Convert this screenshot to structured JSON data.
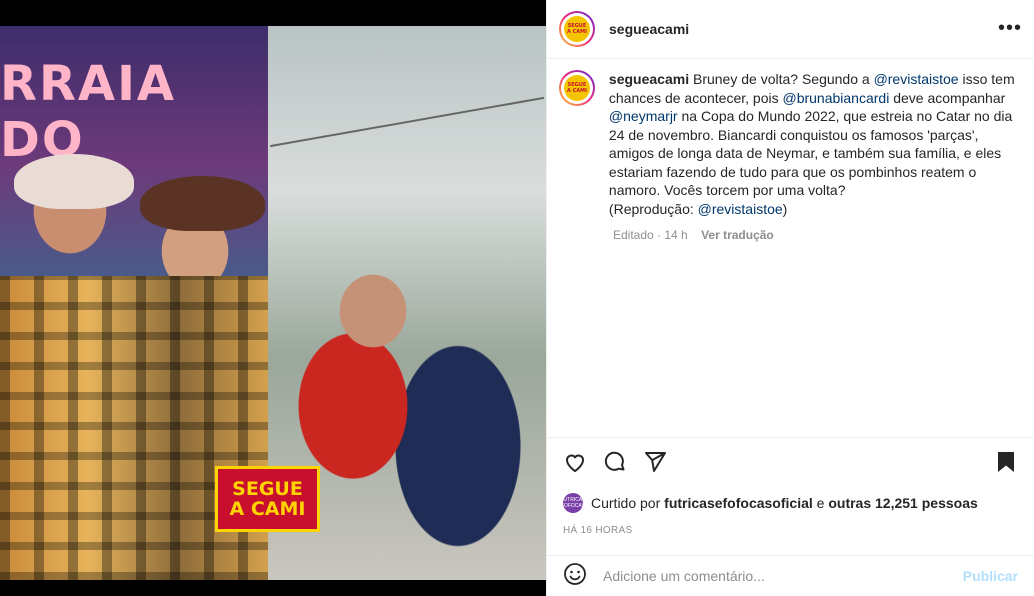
{
  "post": {
    "username": "segueacami",
    "logo_line1": "SEGUE",
    "logo_line2": "A CAMI",
    "banner_text": "RRAIA DO",
    "caption": {
      "part1": "Bruney de volta? Segundo a ",
      "mention1": "@revistaistoe",
      "part2": " isso tem chances de acontecer, pois ",
      "mention2": "@brunabiancardi",
      "part3": " deve acompanhar ",
      "mention3": "@neymarjr",
      "part4": " na Copa do Mundo 2022, que estreia no Catar no dia 24 de novembro. Biancardi conquistou os famosos 'parças', amigos de longa data de Neymar, e também sua família, e eles estariam fazendo de tudo para que os pombinhos reatem o namoro. Vocês torcem por uma volta?",
      "part5": "(Reprodução: ",
      "mention4": "@revistaistoe",
      "part6": ")"
    },
    "meta_edited": "Editado · 14 h",
    "meta_translate": "Ver tradução",
    "likes": {
      "prefix": "Curtido por ",
      "user": "futricasefofocasoficial",
      "mid": " e ",
      "others": "outras 12,251 pessoas",
      "avatar_text": "FUTRICAS FOFOCAS"
    },
    "time_ago": "HÁ 16 HORAS",
    "comment_placeholder": "Adicione um comentário...",
    "publish_label": "Publicar"
  },
  "icons": [
    "more-icon",
    "heart-icon",
    "comment-icon",
    "share-icon",
    "bookmark-icon",
    "emoji-icon"
  ],
  "colors": {
    "mention": "#00376b",
    "muted": "#8e8e8e",
    "publish_disabled": "#b2dffc",
    "brand_red": "#c8102e",
    "brand_yellow": "#ffd400"
  }
}
